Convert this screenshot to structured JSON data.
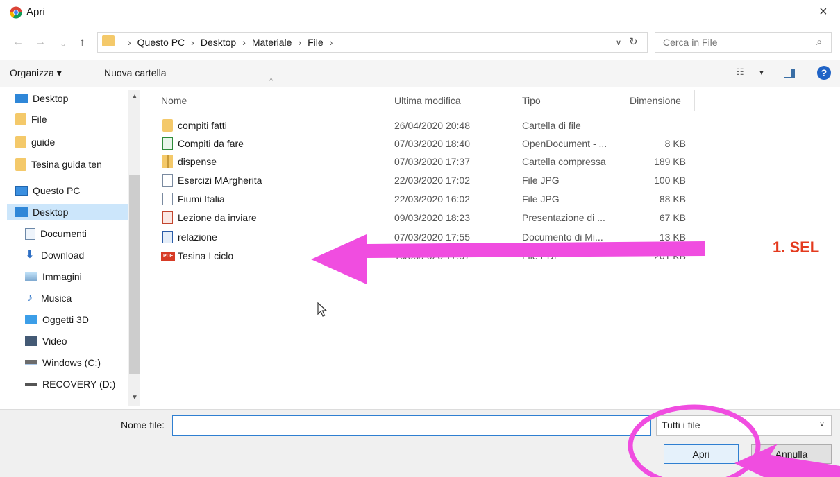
{
  "window": {
    "title": "Apri",
    "close_glyph": "×"
  },
  "address": {
    "breadcrumbs": [
      "Questo PC",
      "Desktop",
      "Materiale",
      "File"
    ],
    "search_placeholder": "Cerca in File"
  },
  "toolbar": {
    "organize_label": "Organizza ▾",
    "new_folder_label": "Nuova cartella"
  },
  "nav": {
    "items": [
      {
        "label": "Desktop",
        "icon": "desktop-icon"
      },
      {
        "label": "File",
        "icon": "folder-icon"
      },
      {
        "label": "guide",
        "icon": "folder-icon"
      },
      {
        "label": "Tesina guida ten",
        "icon": "folder-icon"
      },
      {
        "label": "Questo PC",
        "icon": "computer-icon"
      },
      {
        "label": "Desktop",
        "icon": "desktop-icon",
        "selected": true
      },
      {
        "label": "Documenti",
        "icon": "documents-icon"
      },
      {
        "label": "Download",
        "icon": "download-icon"
      },
      {
        "label": "Immagini",
        "icon": "pictures-icon"
      },
      {
        "label": "Musica",
        "icon": "music-icon"
      },
      {
        "label": "Oggetti 3D",
        "icon": "objects-3d-icon"
      },
      {
        "label": "Video",
        "icon": "video-icon"
      },
      {
        "label": "Windows (C:)",
        "icon": "drive-icon"
      },
      {
        "label": "RECOVERY (D:)",
        "icon": "drive-icon"
      }
    ]
  },
  "files": {
    "columns": [
      "Nome",
      "Ultima modifica",
      "Tipo",
      "Dimensione"
    ],
    "rows": [
      {
        "name": "compiti fatti",
        "date": "26/04/2020 20:48",
        "type": "Cartella di file",
        "size": "",
        "icon": "folder-icon"
      },
      {
        "name": "Compiti da fare",
        "date": "07/03/2020 18:40",
        "type": "OpenDocument - ...",
        "size": "8 KB",
        "icon": "spreadsheet-icon"
      },
      {
        "name": "dispense",
        "date": "07/03/2020 17:37",
        "type": "Cartella compressa",
        "size": "189 KB",
        "icon": "zip-folder-icon"
      },
      {
        "name": "Esercizi MArgherita",
        "date": "22/03/2020 17:02",
        "type": "File JPG",
        "size": "100 KB",
        "icon": "image-file-icon"
      },
      {
        "name": "Fiumi Italia",
        "date": "22/03/2020 16:02",
        "type": "File JPG",
        "size": "88 KB",
        "icon": "image-file-icon"
      },
      {
        "name": "Lezione da inviare",
        "date": "09/03/2020 18:23",
        "type": "Presentazione di ...",
        "size": "67 KB",
        "icon": "presentation-icon"
      },
      {
        "name": "relazione",
        "date": "07/03/2020 17:55",
        "type": "Documento di Mi...",
        "size": "13 KB",
        "icon": "word-document-icon"
      },
      {
        "name": "Tesina I ciclo",
        "date": "16/03/2020 17:57",
        "type": "File PDF",
        "size": "201 KB",
        "icon": "pdf-icon"
      }
    ]
  },
  "annotation": {
    "text": "1. SEL",
    "color": "#e43a1e",
    "marker_color": "#f04de0"
  },
  "bottom": {
    "filename_label": "Nome file:",
    "filename_value": "",
    "filter_label": "Tutti i file",
    "open_label": "Apri",
    "cancel_label": "Annulla"
  }
}
